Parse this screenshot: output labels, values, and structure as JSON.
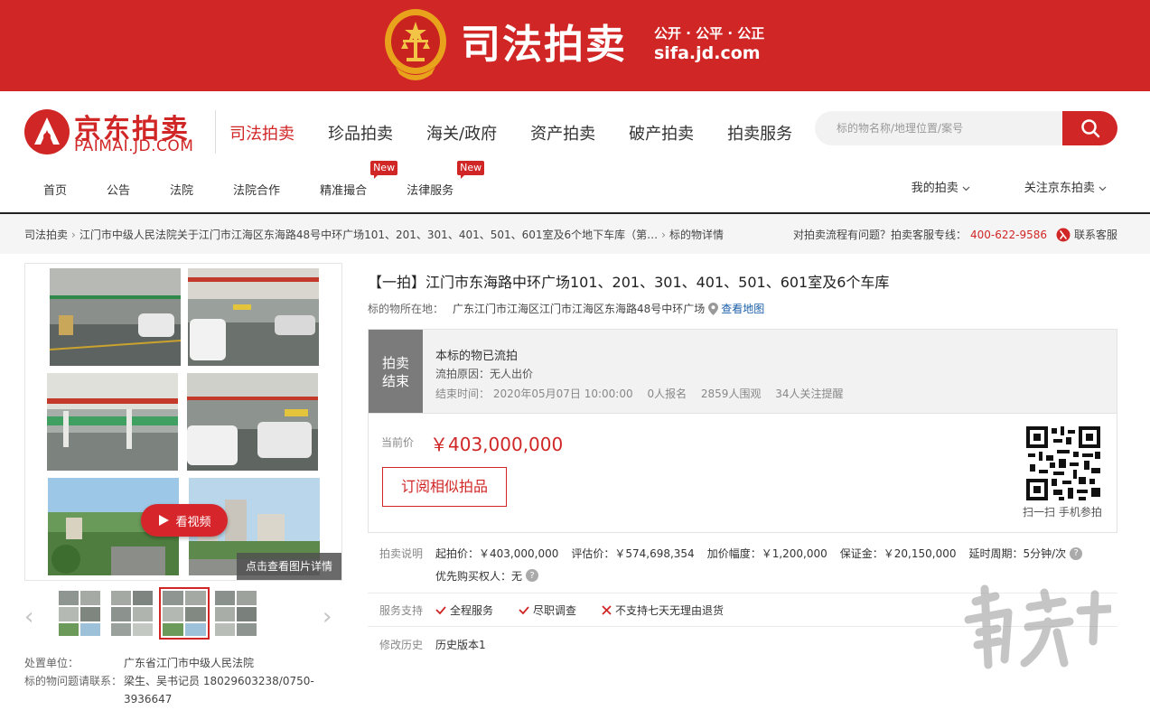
{
  "banner": {
    "title": "司法拍卖",
    "slogan": "公开 · 公平 · 公正",
    "url": "sifa.jd.com"
  },
  "logo": {
    "cn": "京东拍卖",
    "en": "PAIMAI.JD.COM"
  },
  "main_nav": [
    "司法拍卖",
    "珍品拍卖",
    "海关/政府",
    "资产拍卖",
    "破产拍卖",
    "拍卖服务"
  ],
  "search": {
    "placeholder": "标的物名称/地理位置/案号"
  },
  "sub_nav": [
    {
      "label": "首页",
      "badge": ""
    },
    {
      "label": "公告",
      "badge": ""
    },
    {
      "label": "法院",
      "badge": ""
    },
    {
      "label": "法院合作",
      "badge": ""
    },
    {
      "label": "精准撮合",
      "badge": "New"
    },
    {
      "label": "法律服务",
      "badge": "New"
    }
  ],
  "user_links": [
    "我的拍卖",
    "关注京东拍卖"
  ],
  "breadcrumb": {
    "items": [
      "司法拍卖",
      "江门市中级人民法院关于江门市江海区东海路48号中环广场101、201、301、401、501、601室及6个地下车库（第…",
      "标的物详情"
    ],
    "help_text": "对拍卖流程有问题？拍卖客服专线：",
    "phone": "400-622-9586",
    "service": "联系客服"
  },
  "gallery": {
    "video_label": "看视频",
    "detail_label": "点击查看图片详情"
  },
  "disposal": {
    "unit_label": "处置单位：",
    "unit_value": "广东省江门市中级人民法院",
    "contact_label": "标的物问题请联系：",
    "contact_value": "梁生、吴书记员 18029603238/0750-3936647"
  },
  "item": {
    "title": "【一拍】江门市东海路中环广场101、201、301、401、501、601室及6个车库",
    "location_label": "标的物所在地：",
    "location_value": "广东江门市江海区江门市江海区东海路48号中环广场",
    "map_link": "查看地图"
  },
  "status": {
    "tag_line1": "拍卖",
    "tag_line2": "结束",
    "headline": "本标的物已流拍",
    "reason": "流拍原因：无人出价",
    "end_time": "结束时间：  2020年05月07日 10:00:00",
    "signups": "0人报名",
    "viewers": "2859人围观",
    "followers": "34人关注提醒"
  },
  "price": {
    "label": "当前价",
    "value": "￥403,000,000",
    "subscribe": "订阅相似拍品",
    "qr_caption": "扫一扫 手机参拍"
  },
  "auction_info": {
    "label": "拍卖说明",
    "start_price": "起拍价：￥403,000,000",
    "appraisal": "评估价：￥574,698,354",
    "increment": "加价幅度：￥1,200,000",
    "deposit": "保证金：￥20,150,000",
    "delay": "延时周期：5分钟/次",
    "priority": "优先购买权人：无"
  },
  "services": {
    "label": "服务支持",
    "items": [
      "全程服务",
      "尽职调查",
      "不支持七天无理由退货"
    ]
  },
  "history": {
    "label": "修改历史",
    "value": "历史版本1"
  },
  "colors": {
    "brand": "#d12626",
    "link": "#1a5ea8"
  }
}
